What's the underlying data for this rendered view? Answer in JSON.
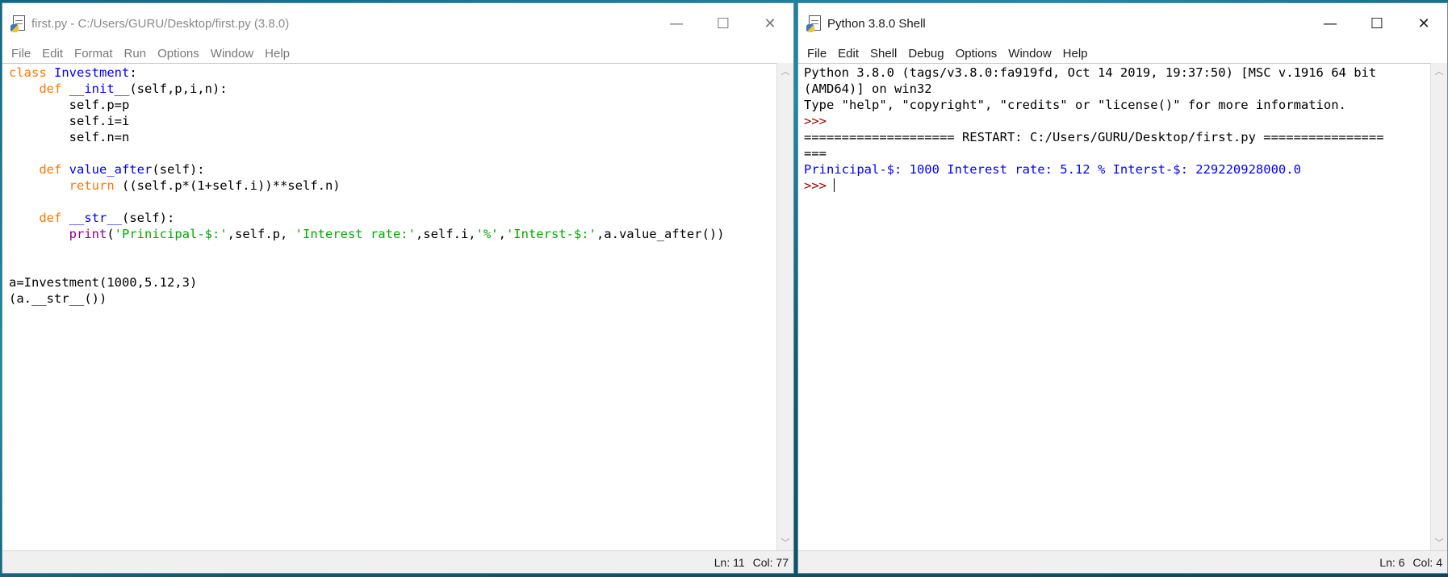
{
  "editor": {
    "title": "first.py - C:/Users/GURU/Desktop/first.py (3.8.0)",
    "menu": [
      "File",
      "Edit",
      "Format",
      "Run",
      "Options",
      "Window",
      "Help"
    ],
    "status": {
      "ln": "Ln: 11",
      "col": "Col: 77"
    },
    "code": [
      [
        [
          "kw",
          "class "
        ],
        [
          "def",
          "Investment"
        ],
        [
          "plain",
          ":"
        ]
      ],
      [
        [
          "plain",
          "    "
        ],
        [
          "kw",
          "def "
        ],
        [
          "def",
          "__init__"
        ],
        [
          "plain",
          "(self,p,i,n):"
        ]
      ],
      [
        [
          "plain",
          "        self.p=p"
        ]
      ],
      [
        [
          "plain",
          "        self.i=i"
        ]
      ],
      [
        [
          "plain",
          "        self.n=n"
        ]
      ],
      [],
      [
        [
          "plain",
          "    "
        ],
        [
          "kw",
          "def "
        ],
        [
          "def",
          "value_after"
        ],
        [
          "plain",
          "(self):"
        ]
      ],
      [
        [
          "plain",
          "        "
        ],
        [
          "kw",
          "return "
        ],
        [
          "plain",
          "((self.p*(1+self.i))**self.n)"
        ]
      ],
      [],
      [
        [
          "plain",
          "    "
        ],
        [
          "kw",
          "def "
        ],
        [
          "def",
          "__str__"
        ],
        [
          "plain",
          "(self):"
        ]
      ],
      [
        [
          "plain",
          "        "
        ],
        [
          "builtin",
          "print"
        ],
        [
          "plain",
          "("
        ],
        [
          "str",
          "'Prinicipal-$:'"
        ],
        [
          "plain",
          ",self.p, "
        ],
        [
          "str",
          "'Interest rate:'"
        ],
        [
          "plain",
          ",self.i,"
        ],
        [
          "str",
          "'%'"
        ],
        [
          "plain",
          ","
        ],
        [
          "str",
          "'Interst-$:'"
        ],
        [
          "plain",
          ",a.value_after())"
        ]
      ],
      [],
      [],
      [
        [
          "plain",
          "a=Investment(1000,5.12,3)"
        ]
      ],
      [
        [
          "plain",
          "(a.__str__())"
        ]
      ]
    ]
  },
  "shell": {
    "title": "Python 3.8.0 Shell",
    "menu": [
      "File",
      "Edit",
      "Shell",
      "Debug",
      "Options",
      "Window",
      "Help"
    ],
    "status": {
      "ln": "Ln: 6",
      "col": "Col: 4"
    },
    "lines": [
      [
        [
          "plain",
          "Python 3.8.0 (tags/v3.8.0:fa919fd, Oct 14 2019, 19:37:50) [MSC v.1916 64 bit"
        ]
      ],
      [
        [
          "plain",
          "(AMD64)] on win32"
        ]
      ],
      [
        [
          "plain",
          "Type \"help\", \"copyright\", \"credits\" or \"license()\" for more information."
        ]
      ],
      [
        [
          "prompt",
          ">>>"
        ]
      ],
      [
        [
          "plain",
          "==================== RESTART: C:/Users/GURU/Desktop/first.py ================"
        ]
      ],
      [
        [
          "plain",
          "==="
        ]
      ],
      [
        [
          "out",
          "Prinicipal-$: 1000 Interest rate: 5.12 % Interst-$: 229220928000.0"
        ]
      ],
      [
        [
          "prompt",
          ">>> "
        ]
      ]
    ]
  },
  "window_controls": {
    "minimize": "—",
    "maximize": "☐",
    "close": "✕"
  }
}
